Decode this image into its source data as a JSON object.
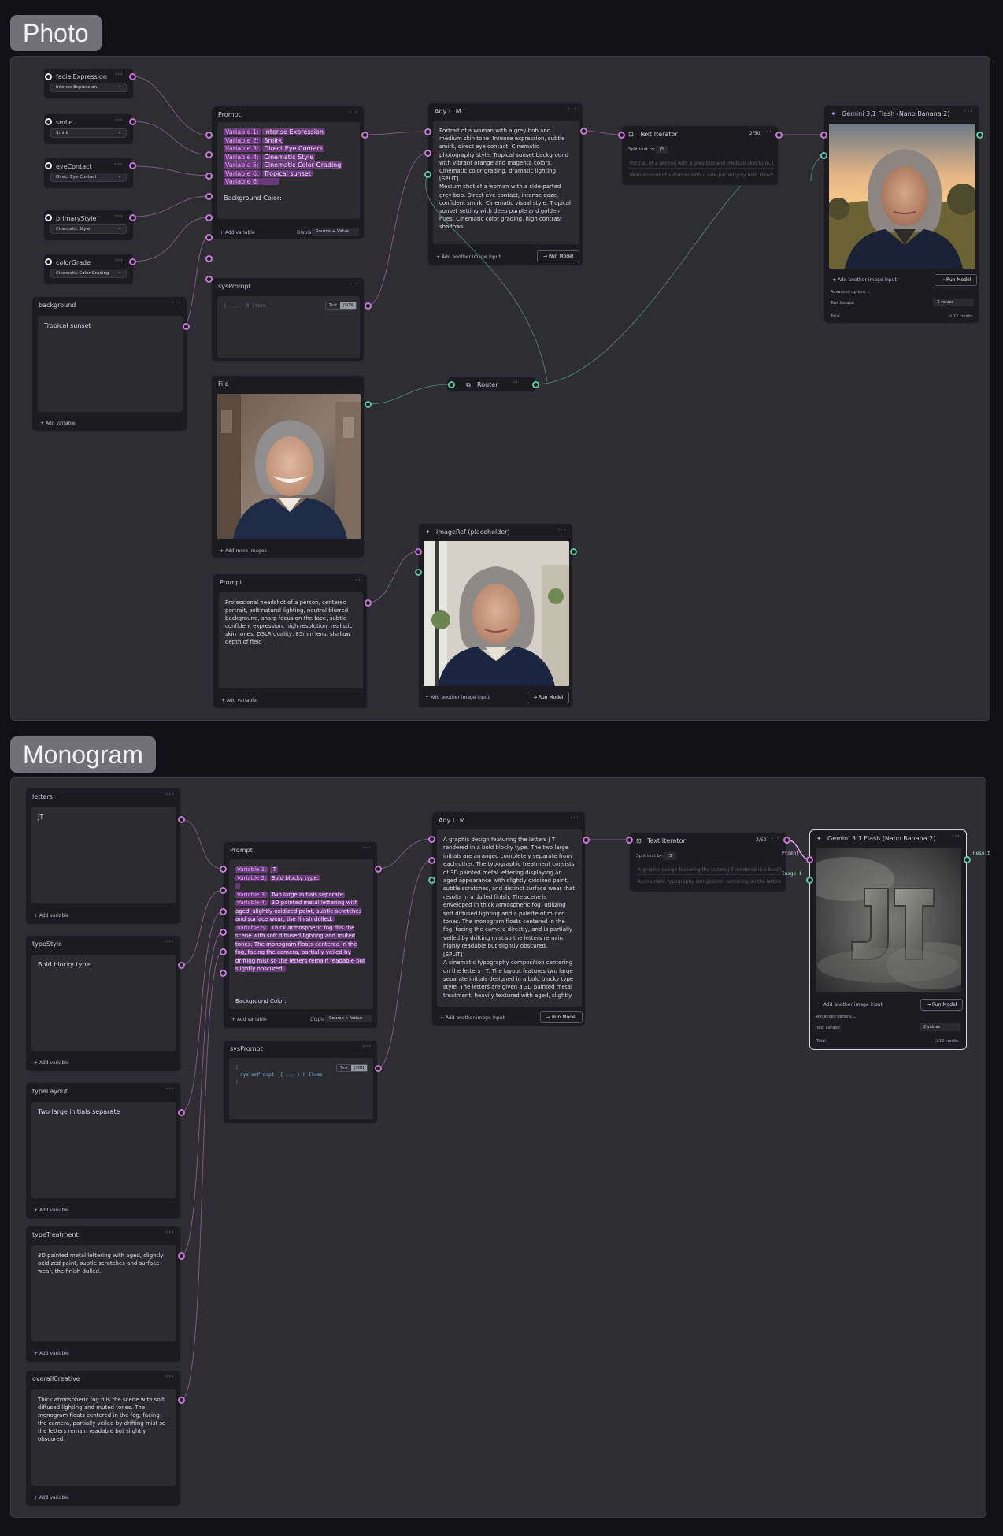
{
  "groups": {
    "photo": "Photo",
    "monogram": "Monogram"
  },
  "photo": {
    "vars": [
      {
        "title": "facialExpression",
        "value": "Intense Expression"
      },
      {
        "title": "smile",
        "value": "Smirk"
      },
      {
        "title": "eyeContact",
        "value": "Direct Eye Contact"
      },
      {
        "title": "primaryStyle",
        "value": "Cinematic Style"
      },
      {
        "title": "colorGrade",
        "value": "Cinematic Color Grading"
      }
    ],
    "background": {
      "title": "background",
      "text": "Tropical sunset",
      "add": "Add variable"
    },
    "prompt": {
      "title": "Prompt",
      "lines": [
        {
          "pill": "Variable 1:",
          "text": "Intense Expression"
        },
        {
          "pill": "Variable 2:",
          "text": "Smirk"
        },
        {
          "pill": "Variable 3:",
          "text": "Direct Eye Contact"
        },
        {
          "pill": "Variable 4:",
          "text": "Cinematic Style"
        },
        {
          "pill": "Variable 5:",
          "text": "Cinematic Color Grading"
        },
        {
          "pill": "Variable 6:",
          "text": "Tropical sunset"
        },
        {
          "pill": "Variable 6:",
          "text": ""
        }
      ],
      "footer_text": "Background Color:",
      "add": "Add variable",
      "display_label": "Display",
      "display_value": "Source + Value"
    },
    "sysprompt": {
      "title": "sysPrompt",
      "code": "{ ... } 0 Items",
      "tog_text": "Text",
      "tog_json": "JSON"
    },
    "file": {
      "title": "File",
      "add": "+ Add more images"
    },
    "router": {
      "title": "Router"
    },
    "prompt2": {
      "title": "Prompt",
      "text": "Professional headshot of a person, centered portrait, soft natural lighting, neutral blurred background, sharp focus on the face, subtle confident expression, high resolution, realistic skin tones, DSLR quality, 85mm lens, shallow depth of field",
      "add": "Add variable"
    },
    "imageref": {
      "title": "imageRef (placeholder)",
      "add": "Add another image input",
      "run": "Run Model"
    },
    "llm": {
      "title": "Any LLM",
      "text": "Portrait of a woman with a grey bob and medium skin tone. Intense expression, subtle smirk, direct eye contact. Cinematic photography style. Tropical sunset background with vibrant orange and magenta colors. Cinematic color grading, dramatic lighting.\n[SPLIT]\nMedium shot of a woman with a side-parted grey bob. Direct eye contact, intense gaze, confident smirk. Cinematic visual style. Tropical sunset setting with deep purple and golden hues. Cinematic color grading, high contrast shadows.",
      "add": "Add another image input",
      "run": "Run Model"
    },
    "iterator": {
      "title": "Text Iterator",
      "count": "2/50",
      "split_label": "Split text by:",
      "split_value": "[S",
      "item1": "Portrait of a woman with a grey bob and medium skin tone. Intense ex",
      "item2": "Medium shot of a woman with a side-parted grey bob. Direct eye conta"
    },
    "gemini": {
      "title": "Gemini 3.1 Flash (Nano Banana 2)",
      "add": "Add another image input",
      "run": "Run Model",
      "advanced": "Advanced options",
      "iter_label": "Text Iterator",
      "iter_value": "2 values",
      "total_label": "Total",
      "credits": "12 credits"
    }
  },
  "monogram": {
    "vars": [
      {
        "title": "letters",
        "text": "JT",
        "add": "Add variable"
      },
      {
        "title": "typeStyle",
        "text": "Bold blocky type.",
        "add": "Add variable"
      },
      {
        "title": "typeLayout",
        "text": "Two large initials separate",
        "add": "Add variable"
      },
      {
        "title": "typeTreatment",
        "text": "3D painted metal lettering with aged, slightly oxidized paint, subtle scratches and surface wear, the finish dulled.",
        "add": "Add variable"
      },
      {
        "title": "overallCreative",
        "text": "Thick atmospheric fog fills the scene with soft diffused lighting and muted tones. The monogram floats centered in the fog, facing the camera, partially veiled by drifting mist so the letters remain readable but slightly obscured.",
        "add": "Add variable"
      }
    ],
    "prompt": {
      "title": "Prompt",
      "lines": [
        {
          "pill": "Variable 1:",
          "text": "JT"
        },
        {
          "pill": "Variable 2:",
          "text": "Bold blocky type."
        },
        {
          "pill": "",
          "text": ""
        },
        {
          "pill": "Variable 3:",
          "text": "Two large initials separate"
        },
        {
          "pill": "Variable 4:",
          "text": "3D painted metal lettering with aged, slightly oxidized paint, subtle scratches and surface wear, the finish dulled."
        },
        {
          "pill": "Variable 5:",
          "text": "Thick atmospheric fog fills the scene with soft diffused lighting and muted tones. The monogram floats centered in the fog, facing the camera, partially veiled by drifting mist so the letters remain readable but slightly obscured."
        }
      ],
      "footer_text": "Background Color:",
      "add": "Add variable",
      "display_label": "Display",
      "display_value": "Source + Value"
    },
    "sysprompt": {
      "title": "sysPrompt",
      "code1": "{",
      "code2": "systemPrompt: { ... } 0 Items",
      "code3": "}",
      "tog_text": "Text",
      "tog_json": "JSON"
    },
    "llm": {
      "title": "Any LLM",
      "text": "A graphic design featuring the letters J T rendered in a bold blocky type. The two large initials are arranged completely separate from each other. The typographic treatment consists of 3D painted metal lettering displaying an aged appearance with slightly oxidized paint, subtle scratches, and distinct surface wear that results in a dulled finish. The scene is enveloped in thick atmospheric fog, utilizing soft diffused lighting and a palette of muted tones. The monogram floats centered in the fog, facing the camera directly, and is partially veiled by drifting mist so the letters remain highly readable but slightly obscured.\n[SPLIT]\nA cinematic typography composition centering on the letters J T. The layout features two large separate initials designed in a bold blocky type style. The letters are given a 3D painted metal treatment, heavily textured with aged, slightly",
      "add": "Add another image input",
      "run": "Run Model"
    },
    "iterator": {
      "title": "Text Iterator",
      "count": "2/50",
      "split_label": "Split text by:",
      "split_value": "[S",
      "item1": "A graphic design featuring the letters J T rendered in a bold blocky typ",
      "item2": "A cinematic typography composition centering on the letters J T. The"
    },
    "gemini": {
      "title": "Gemini 3.1 Flash (Nano Banana 2)",
      "add": "Add another image input",
      "run": "Run Model",
      "advanced": "Advanced options",
      "iter_label": "Text Iterator",
      "iter_value": "2 values",
      "total_label": "Total",
      "credits": "12 credits",
      "wire_prompt": "Prompt*",
      "wire_image": "Image 1",
      "wire_result": "Result"
    }
  }
}
